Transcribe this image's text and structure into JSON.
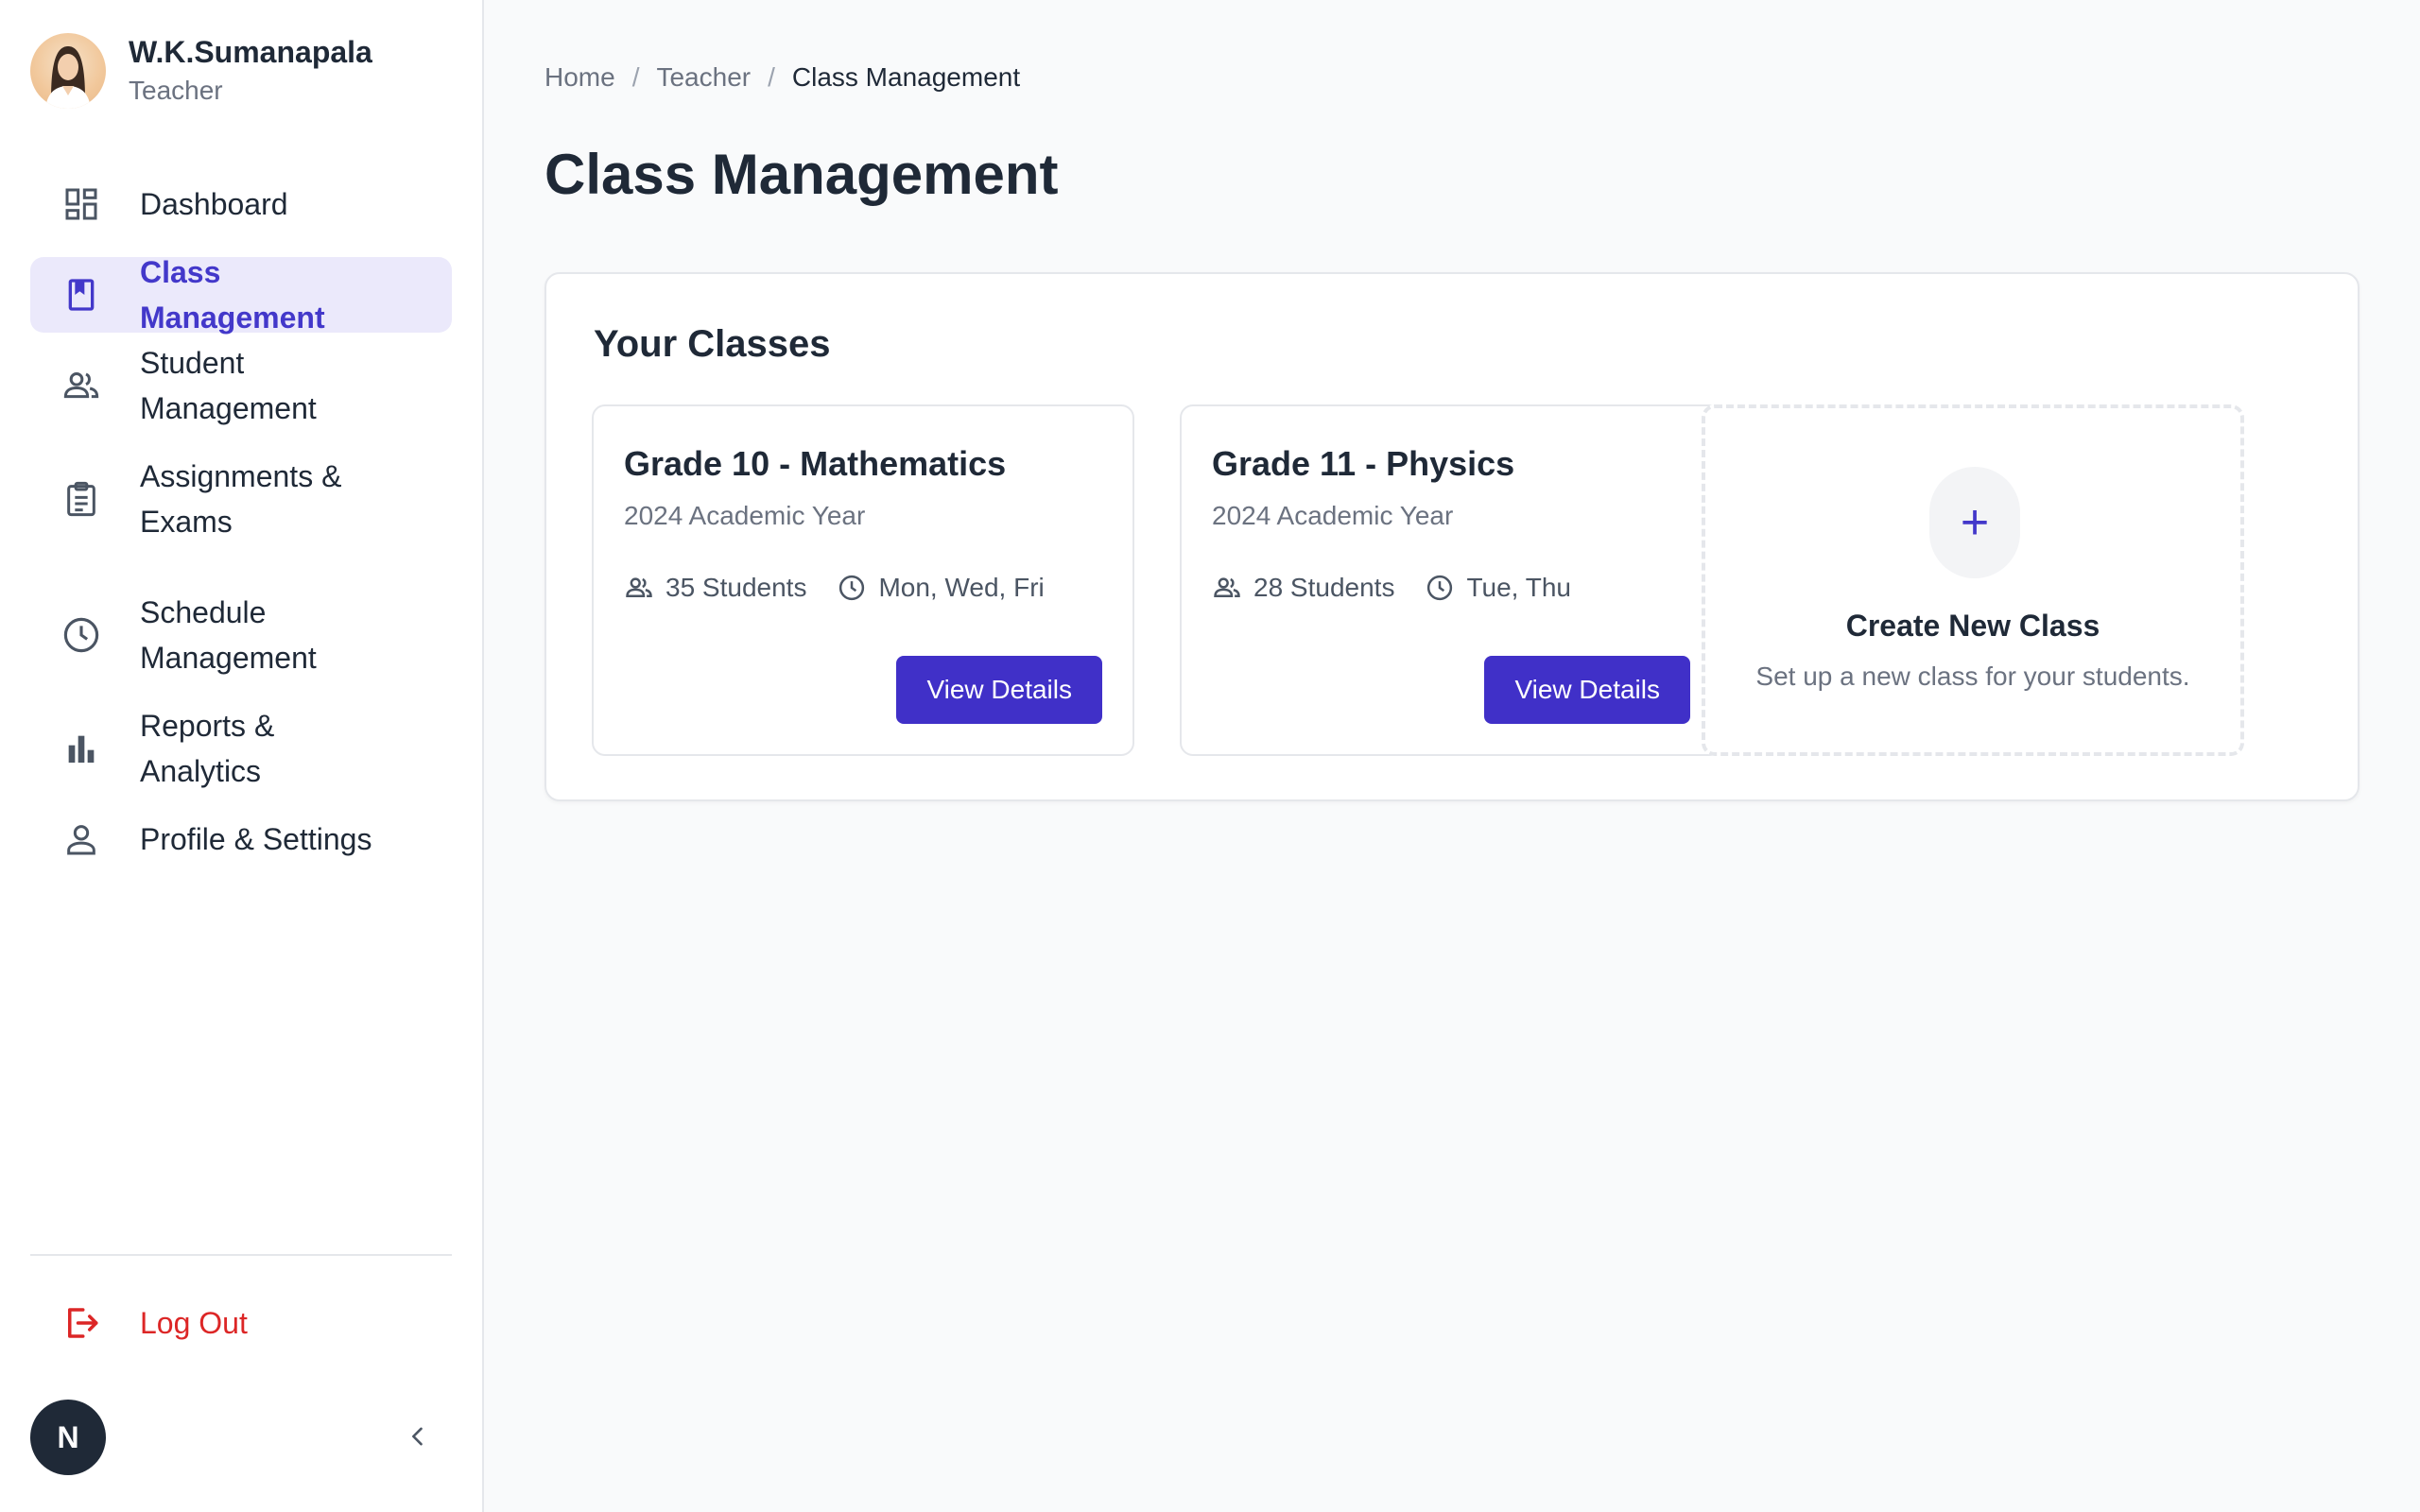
{
  "user": {
    "name": "W.K.Sumanapala",
    "role": "Teacher",
    "initial": "N"
  },
  "sidebar": {
    "items": [
      {
        "label": "Dashboard",
        "icon": "dashboard-icon"
      },
      {
        "label": "Class Management",
        "icon": "bookmark-book-icon",
        "active": true
      },
      {
        "label": "Student Management",
        "icon": "people-icon"
      },
      {
        "label": "Assignments & Exams",
        "icon": "clipboard-icon"
      },
      {
        "label": "Schedule Management",
        "icon": "clock-icon"
      },
      {
        "label": "Reports & Analytics",
        "icon": "bar-chart-icon"
      },
      {
        "label": "Profile & Settings",
        "icon": "person-icon"
      }
    ],
    "logout_label": "Log Out"
  },
  "breadcrumb": [
    "Home",
    "Teacher",
    "Class Management"
  ],
  "page_title": "Class Management",
  "panel": {
    "title": "Your Classes",
    "classes": [
      {
        "title": "Grade 10 - Mathematics",
        "year": "2024 Academic Year",
        "students": "35 Students",
        "days": "Mon, Wed, Fri",
        "button": "View Details"
      },
      {
        "title": "Grade 11 - Physics",
        "year": "2024 Academic Year",
        "students": "28 Students",
        "days": "Tue, Thu",
        "button": "View Details"
      }
    ],
    "create": {
      "symbol": "+",
      "title": "Create New Class",
      "subtitle": "Set up a new class for your students."
    }
  },
  "colors": {
    "accent": "#4030c8",
    "active_bg": "#ebe9fb",
    "danger": "#dc2626"
  }
}
